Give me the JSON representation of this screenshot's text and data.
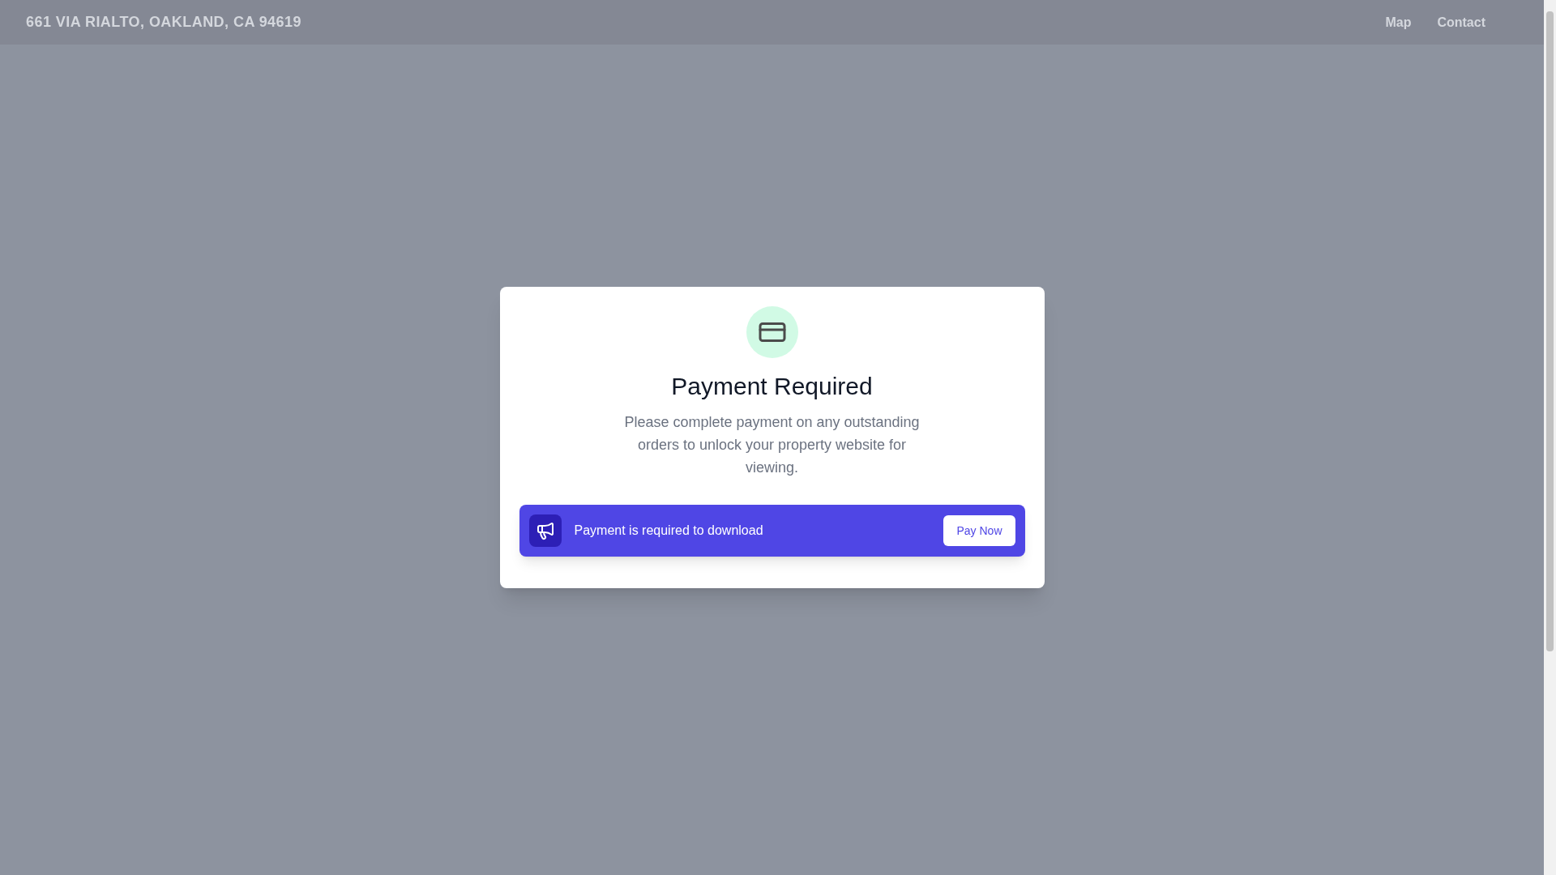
{
  "header": {
    "title": "661 VIA RIALTO, OAKLAND, CA 94619",
    "links": [
      "Map",
      "Contact"
    ]
  },
  "dialog": {
    "title": "Payment Required",
    "message": "Please complete payment on any outstanding orders to unlock your property website for viewing.",
    "banner": {
      "text": "Payment is required to download",
      "button": "Pay Now"
    }
  }
}
